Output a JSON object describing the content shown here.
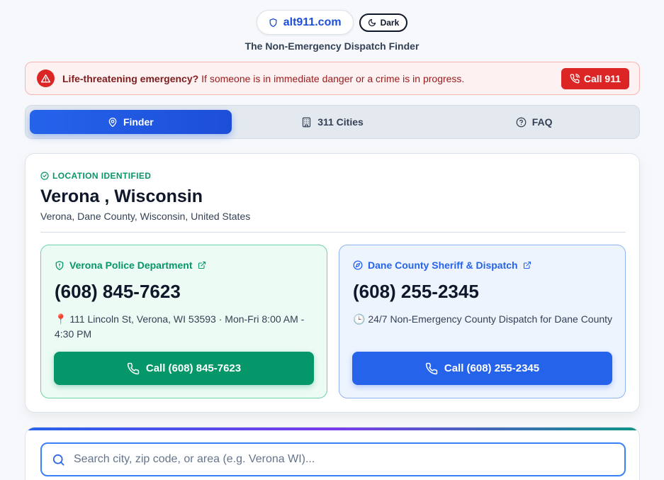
{
  "header": {
    "brand": "alt911.com",
    "brand_icon": "shield-icon",
    "theme_toggle_label": "Dark",
    "tagline": "The Non-Emergency Dispatch Finder"
  },
  "alert": {
    "strong": "Life-threatening emergency?",
    "text": "If someone is in immediate danger or a crime is in progress.",
    "button_label": "Call 911"
  },
  "tabs": [
    {
      "label": "Finder",
      "icon": "map-pin-icon",
      "active": true
    },
    {
      "label": "311 Cities",
      "icon": "building-icon",
      "active": false
    },
    {
      "label": "FAQ",
      "icon": "help-circle-icon",
      "active": false
    }
  ],
  "location": {
    "status": "LOCATION IDENTIFIED",
    "title": "Verona , Wisconsin",
    "full": "Verona, Dane County, Wisconsin, United States"
  },
  "agencies": [
    {
      "name": "Verona Police Department",
      "phone": "(608) 845-7623",
      "info": "111 Lincoln St, Verona, WI 53593 · Mon-Fri 8:00 AM - 4:30 PM",
      "info_icon": "📍",
      "button_label": "Call (608) 845-7623"
    },
    {
      "name": "Dane County Sheriff & Dispatch",
      "phone": "(608) 255-2345",
      "info": "24/7 Non-Emergency County Dispatch for Dane County",
      "info_icon": "🕒",
      "button_label": "Call (608) 255-2345"
    }
  ],
  "search": {
    "placeholder": "Search city, zip code, or area (e.g. Verona WI)...",
    "value": ""
  },
  "colors": {
    "accent": "#2563eb",
    "success": "#059669",
    "danger": "#dc2626"
  }
}
